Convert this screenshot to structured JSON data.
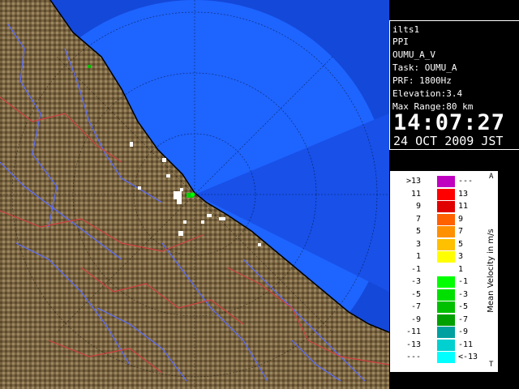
{
  "info": {
    "lines": [
      "ilts1",
      "PPI",
      "OUMU_A_V",
      "Task: OUMU_A",
      "PRF: 1800Hz",
      "Elevation:3.4",
      "Max Range:80 km"
    ],
    "time": "14:07:27",
    "date": "24 OCT 2009 JST"
  },
  "legend": {
    "title": "Mean Velocity in m/s",
    "corner_top": "A",
    "corner_bottom": "T",
    "rows": [
      {
        "left": ">13",
        "right": "---",
        "color": "#c000c0"
      },
      {
        "left": "11",
        "right": "13",
        "color": "#ff0000"
      },
      {
        "left": "9",
        "right": "11",
        "color": "#e00000"
      },
      {
        "left": "7",
        "right": "9",
        "color": "#ff6000"
      },
      {
        "left": "5",
        "right": "7",
        "color": "#ff9000"
      },
      {
        "left": "3",
        "right": "5",
        "color": "#ffc000"
      },
      {
        "left": "1",
        "right": "3",
        "color": "#ffff00"
      },
      {
        "left": "-1",
        "right": "1",
        "color": "#ffffff"
      },
      {
        "left": "-3",
        "right": "-1",
        "color": "#00ff00"
      },
      {
        "left": "-5",
        "right": "-3",
        "color": "#00e000"
      },
      {
        "left": "-7",
        "right": "-5",
        "color": "#00c000"
      },
      {
        "left": "-9",
        "right": "-7",
        "color": "#00a000"
      },
      {
        "left": "-11",
        "right": "-9",
        "color": "#00a0a0"
      },
      {
        "left": "-13",
        "right": "-11",
        "color": "#00d0d0"
      },
      {
        "left": "---",
        "right": "<-13",
        "color": "#00ffff"
      }
    ]
  },
  "colors": {
    "sea": "#1e64ff",
    "sea_dark": "#1448d8",
    "land": "#7a6440",
    "river": "#5a6cff",
    "border": "#d04040"
  }
}
